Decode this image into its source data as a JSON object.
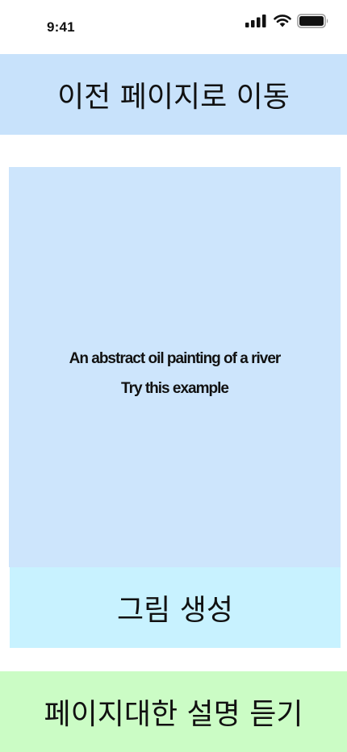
{
  "status_bar": {
    "time": "9:41",
    "icons": [
      "cellular-signal-icon",
      "wifi-icon",
      "battery-icon"
    ]
  },
  "back_button": {
    "label": "이전 페이지로 이동"
  },
  "image_panel": {
    "prompt": "An abstract oil painting of a river",
    "try_example": "Try this example"
  },
  "generate_button": {
    "label": "그림 생성"
  },
  "listen_button": {
    "label": "페이지대한 설명 듣기"
  },
  "colors": {
    "back_button_bg": "#c8e2fb",
    "image_panel_bg": "#cde5fc",
    "generate_button_bg": "#c8f2ff",
    "listen_button_bg": "#cbfcc5"
  }
}
